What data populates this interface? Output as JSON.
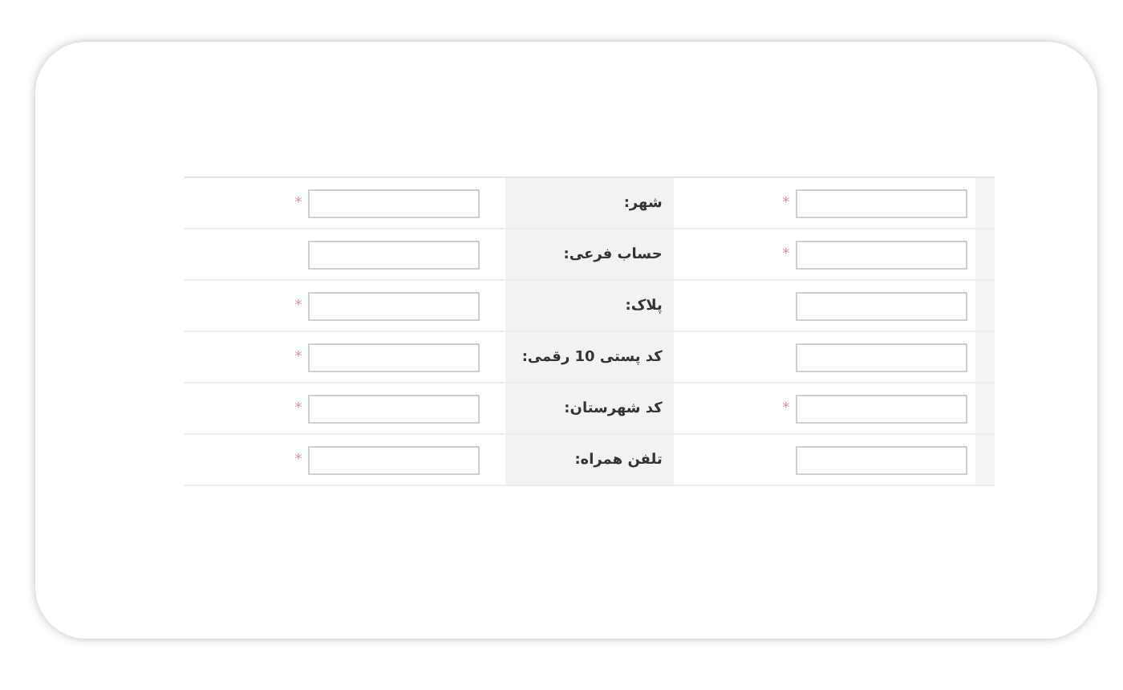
{
  "rows": [
    {
      "label": "شهر:",
      "right_mark": "*",
      "left_mark": "*"
    },
    {
      "label": "حساب فرعی:",
      "right_mark": "*"
    },
    {
      "label": "پلاک:",
      "left_mark": "*"
    },
    {
      "label": "کد پستی 10 رقمی:",
      "left_mark": "*"
    },
    {
      "label": "کد شهرستان:",
      "right_mark": "*",
      "left_mark": "*"
    },
    {
      "label": "تلفن همراه:",
      "left_mark": "*"
    }
  ]
}
